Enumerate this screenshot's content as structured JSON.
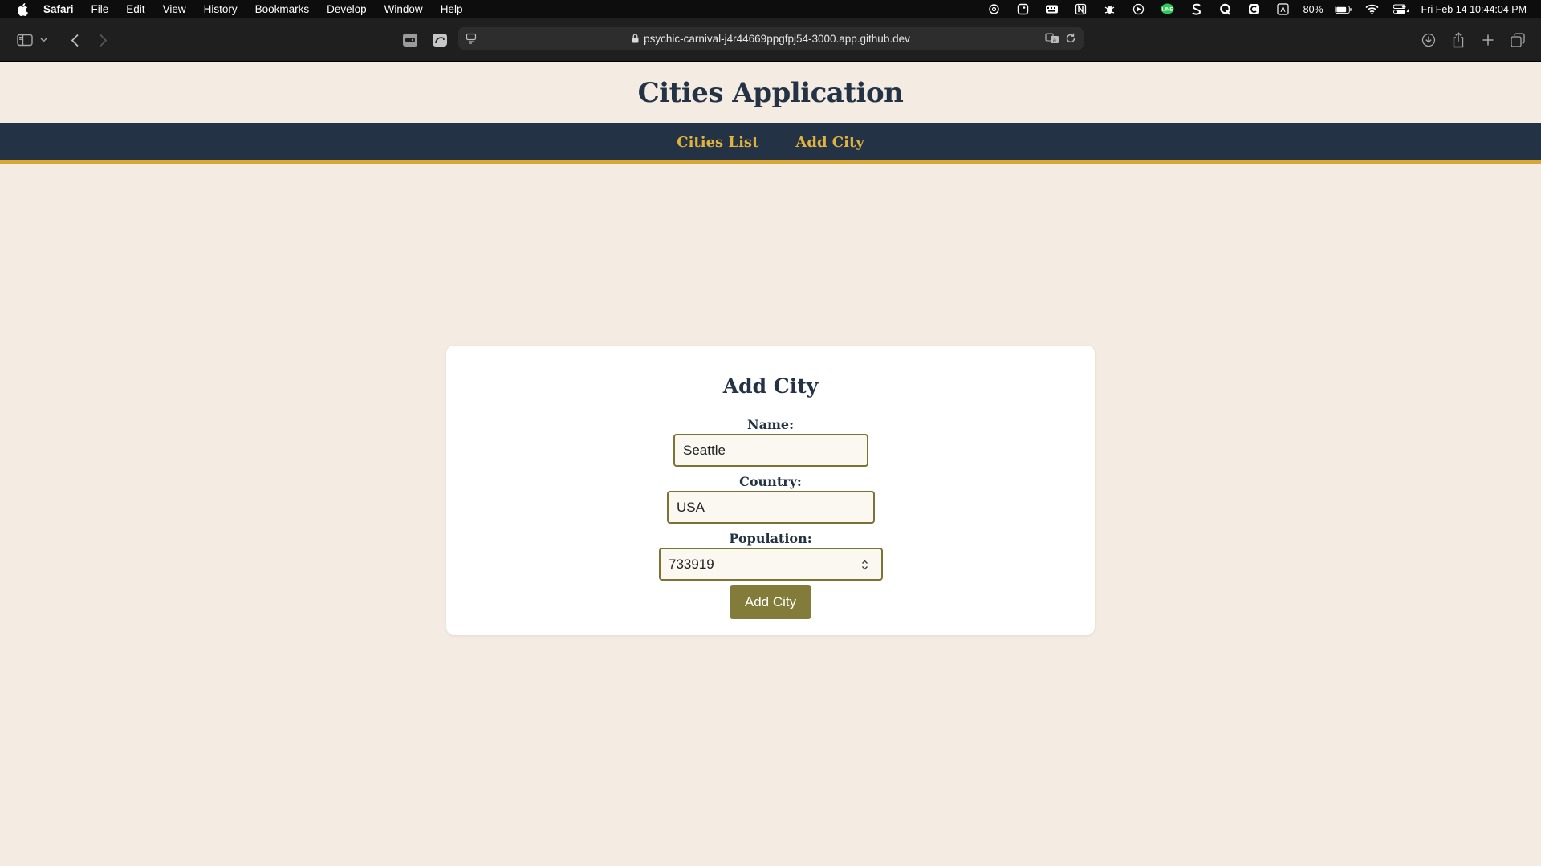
{
  "menubar": {
    "items": [
      "Safari",
      "File",
      "Edit",
      "View",
      "History",
      "Bookmarks",
      "Develop",
      "Window",
      "Help"
    ],
    "battery": "80%",
    "datetime": "Fri Feb 14  10:44:04 PM"
  },
  "browser": {
    "url": "psychic-carnival-j4r44669ppgfpj54-3000.app.github.dev"
  },
  "site": {
    "title": "Cities Application",
    "nav": [
      "Cities List",
      "Add City"
    ]
  },
  "form": {
    "title": "Add City",
    "name_label": "Name:",
    "name_value": "Seattle",
    "country_label": "Country:",
    "country_value": "USA",
    "population_label": "Population:",
    "population_value": "733919",
    "submit_label": "Add City"
  },
  "colors": {
    "page_background": "#f4ebe2",
    "nav_background": "#233345",
    "nav_accent": "#d9a635",
    "nav_link": "#e2b23f",
    "button": "#827b3a",
    "input_border": "#7b7334"
  }
}
